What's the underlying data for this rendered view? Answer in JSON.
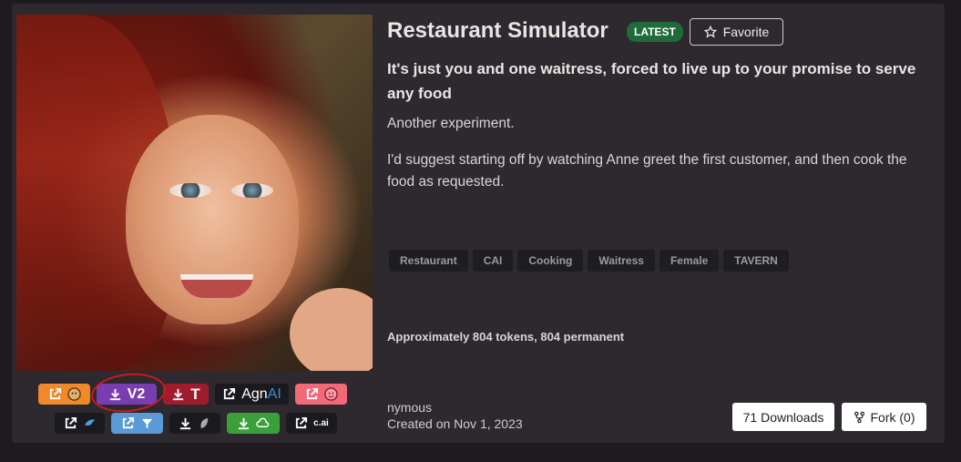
{
  "card": {
    "title": "Restaurant Simulator",
    "badge": "LATEST",
    "favorite_label": "Favorite",
    "subtitle": "It's just you and one waitress, forced to live up to your promise to serve any food",
    "description": [
      "Another experiment.",
      "I'd suggest starting off by watching Anne greet the first customer, and then cook the food as requested."
    ],
    "tags": [
      "Restaurant",
      "CAI",
      "Cooking",
      "Waitress",
      "Female",
      "TAVERN"
    ],
    "tokens": "Approximately 804 tokens, 804 permanent",
    "author": "nymous",
    "created": "Created on Nov 1, 2023",
    "downloads_label": "71 Downloads",
    "fork_label": "Fork (0)"
  },
  "link_buttons": {
    "row1": [
      {
        "icon": "external-link-icon",
        "brand": "avatar-face-icon",
        "color": "#f0892a"
      },
      {
        "icon": "download-icon",
        "text": "V2",
        "color": "#7a3db0"
      },
      {
        "icon": "download-icon",
        "text": "T",
        "color": "#a01c2c"
      },
      {
        "icon": "external-link-icon",
        "text_a": "Agn",
        "text_b": "AI",
        "color": "#1a1a1e"
      },
      {
        "icon": "external-link-icon",
        "brand": "smiley-face-icon",
        "color": "#f06a78"
      }
    ],
    "row2": [
      {
        "icon": "external-link-icon",
        "brand": "bird-icon",
        "color": "#1a1a1e"
      },
      {
        "icon": "external-link-icon",
        "brand": "funnel-icon",
        "color": "#5a9ad8"
      },
      {
        "icon": "download-icon",
        "brand": "leaf-icon",
        "color": "#1a1a1e"
      },
      {
        "icon": "download-icon",
        "brand": "cloud-icon",
        "color": "#3aa03a"
      },
      {
        "icon": "external-link-icon",
        "text": "c.ai",
        "color": "#1a1a1e"
      }
    ]
  }
}
